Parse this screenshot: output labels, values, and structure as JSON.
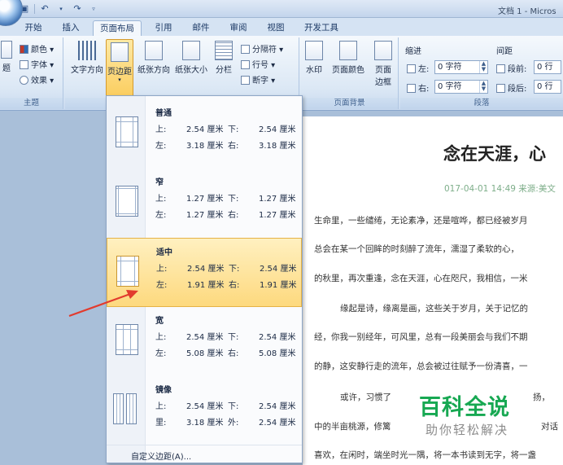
{
  "window": {
    "title": "文档 1 - Micros"
  },
  "tabs": [
    "开始",
    "插入",
    "页面布局",
    "引用",
    "邮件",
    "审阅",
    "视图",
    "开发工具"
  ],
  "active_tab": "页面布局",
  "ribbon": {
    "theme_group": {
      "label": "主题",
      "theme_label": "题",
      "colors": "颜色",
      "fonts": "字体",
      "effects": "效果"
    },
    "page_setup": {
      "text_direction": "文字方向",
      "margins": "页边距",
      "orientation": "纸张方向",
      "size": "纸张大小",
      "columns": "分栏",
      "breaks": "分隔符",
      "line_numbers": "行号",
      "hyphenation": "断字"
    },
    "page_background": {
      "label": "页面背景",
      "watermark": "水印",
      "page_color": "页面颜色",
      "page_border_1": "页面",
      "page_border_2": "边框"
    },
    "paragraph": {
      "label": "段落",
      "indent_title": "缩进",
      "spacing_title": "间距",
      "indent_left_label": "左:",
      "indent_left_value": "0 字符",
      "indent_right_label": "右:",
      "indent_right_value": "0 字符",
      "before_label": "段前:",
      "before_value": "0 行",
      "after_label": "段后:",
      "after_value": "0 行"
    }
  },
  "margins_menu": {
    "items": [
      {
        "name": "普通",
        "r1a": "上:",
        "r1b": "2.54 厘米",
        "r1c": "下:",
        "r1d": "2.54 厘米",
        "r2a": "左:",
        "r2b": "3.18 厘米",
        "r2c": "右:",
        "r2d": "3.18 厘米"
      },
      {
        "name": "窄",
        "r1a": "上:",
        "r1b": "1.27 厘米",
        "r1c": "下:",
        "r1d": "1.27 厘米",
        "r2a": "左:",
        "r2b": "1.27 厘米",
        "r2c": "右:",
        "r2d": "1.27 厘米"
      },
      {
        "name": "适中",
        "r1a": "上:",
        "r1b": "2.54 厘米",
        "r1c": "下:",
        "r1d": "2.54 厘米",
        "r2a": "左:",
        "r2b": "1.91 厘米",
        "r2c": "右:",
        "r2d": "1.91 厘米"
      },
      {
        "name": "宽",
        "r1a": "上:",
        "r1b": "2.54 厘米",
        "r1c": "下:",
        "r1d": "2.54 厘米",
        "r2a": "左:",
        "r2b": "5.08 厘米",
        "r2c": "右:",
        "r2d": "5.08 厘米"
      },
      {
        "name": "镜像",
        "r1a": "上:",
        "r1b": "2.54 厘米",
        "r1c": "下:",
        "r1d": "2.54 厘米",
        "r2a": "里:",
        "r2b": "3.18 厘米",
        "r2c": "外:",
        "r2d": "2.54 厘米"
      }
    ],
    "selected": "适中",
    "custom": "自定义边距(A)..."
  },
  "document": {
    "title": "念在天涯，心",
    "meta": "017-04-01 14:49 来源:美文",
    "paragraphs": [
      "生命里，一些缱绻，无论素净，还是喧哗，都已经被岁月",
      "总会在某一个回眸的时刻醉了流年，濡湿了柔软的心，",
      "的秋里，再次重逢，念在天涯，心在咫尺，我相信，一米",
      "缘起是诗，缘离是画，这些关于岁月，关于记忆的",
      "经，你我一别经年，可风里，总有一段美丽会与我们不期",
      "的静，这安静行走的流年，总会被过往赋予一份清喜，一",
      "或许，习惯了",
      "中的半亩桃源，修篱",
      "喜欢，在闲时，端坐时光一隅，将一本书读到无字，将一盏"
    ],
    "para_tails": [
      "扬，",
      "对话"
    ]
  },
  "watermark": {
    "main": "百科全说",
    "sub": "助你轻松解决"
  },
  "colors": {
    "accent": "#1e5aa8",
    "selected_item": "#fdd97e",
    "arrow": "#e23b2e",
    "watermark_green": "#17a852"
  }
}
